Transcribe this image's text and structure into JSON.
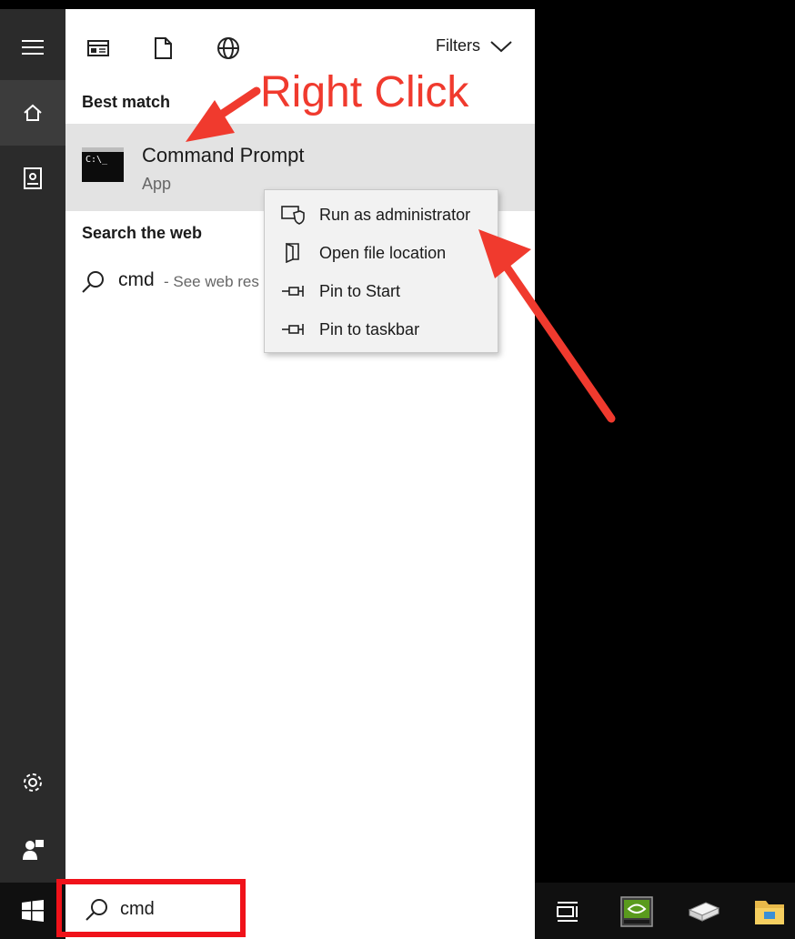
{
  "rail": {
    "items": [
      {
        "icon": "hamburger-menu-icon"
      },
      {
        "icon": "home-icon"
      },
      {
        "icon": "documents-icon"
      },
      {
        "icon": "settings-gear-icon"
      },
      {
        "icon": "user-feedback-icon"
      }
    ]
  },
  "topbar": {
    "icons": [
      "apps-icon",
      "document-icon",
      "web-globe-icon"
    ],
    "filters_label": "Filters"
  },
  "results": {
    "best_match_heading": "Best match",
    "best_match": {
      "title": "Command Prompt",
      "subtitle": "App",
      "icon_text": "C:\\_"
    },
    "web_heading": "Search the web",
    "web_item": {
      "query": "cmd",
      "hint": "- See web res"
    }
  },
  "context_menu": {
    "items": [
      {
        "label": "Run as administrator",
        "icon": "shield-run-icon"
      },
      {
        "label": "Open file location",
        "icon": "folder-location-icon"
      },
      {
        "label": "Pin to Start",
        "icon": "pin-icon"
      },
      {
        "label": "Pin to taskbar",
        "icon": "pin-icon"
      }
    ]
  },
  "taskbar": {
    "search_text": "cmd",
    "icons": [
      "windows-start-icon",
      "task-view-icon",
      "nvidia-icon",
      "drive-icon",
      "file-explorer-icon"
    ]
  },
  "annotations": {
    "right_click_label": "Right Click",
    "color": "#f03a2e",
    "highlight_color": "#f0121a"
  },
  "colors": {
    "rail_bg": "#2b2b2b",
    "selected_bg": "#e3e3e3",
    "menu_bg": "#f2f2f2"
  }
}
